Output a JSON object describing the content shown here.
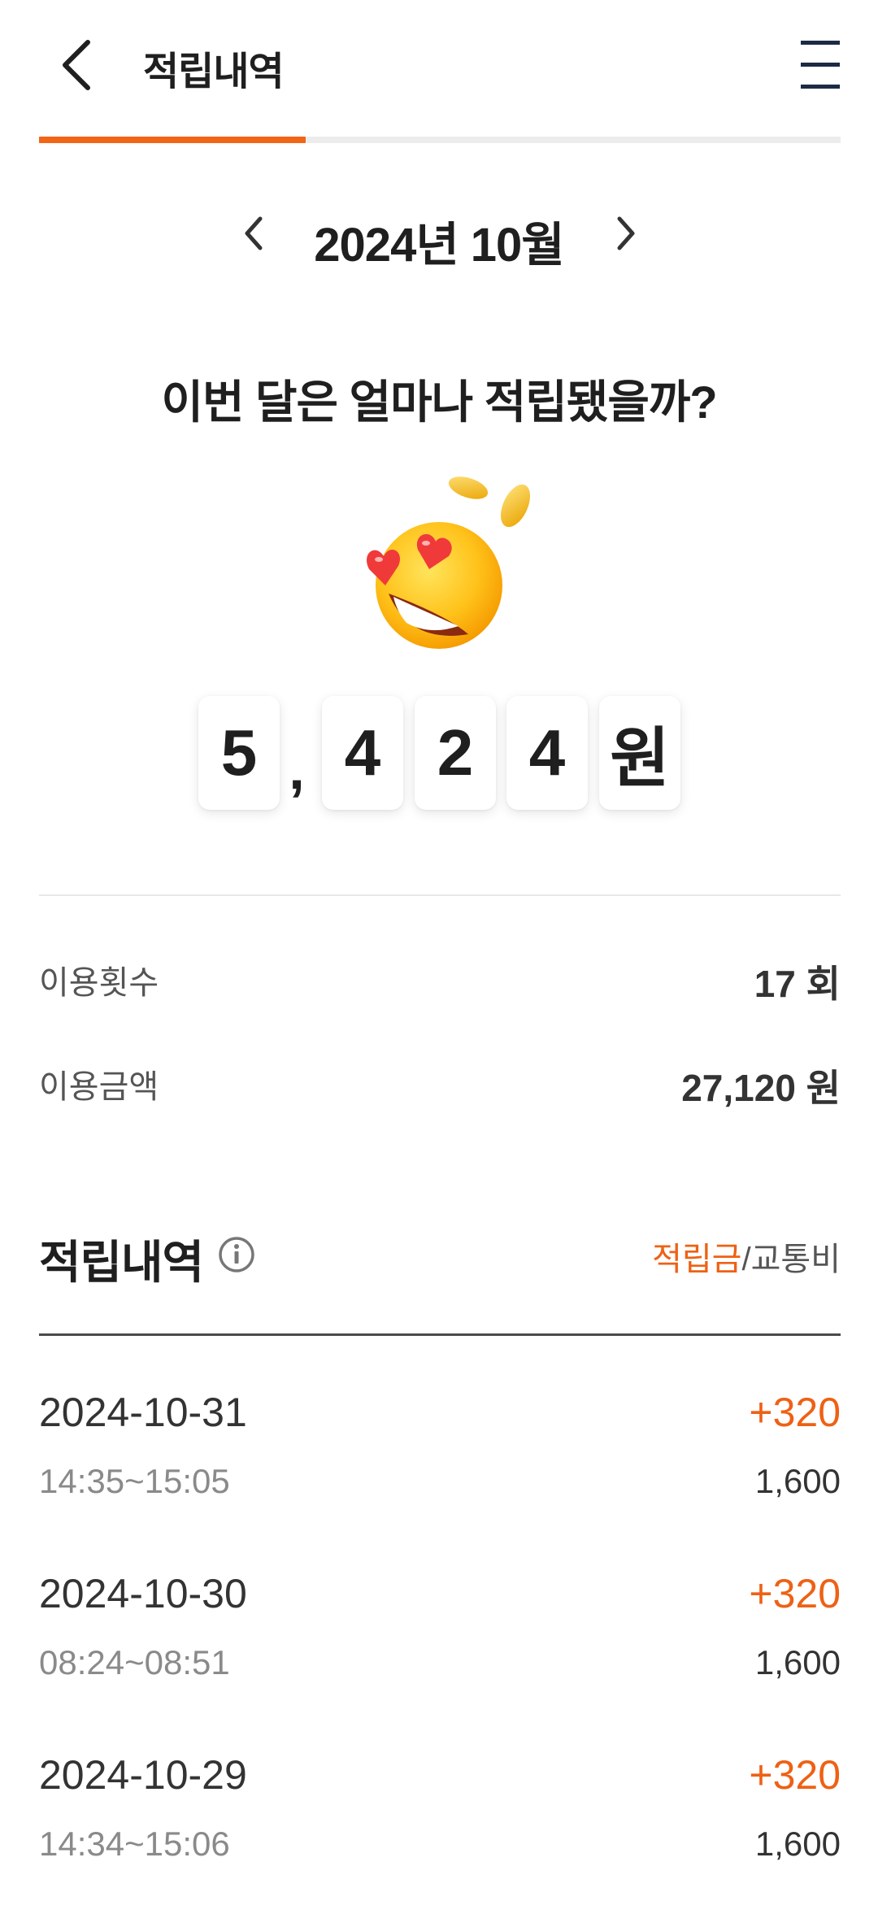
{
  "header": {
    "title": "적립내역",
    "back_icon": "chevron-left-icon",
    "menu_icon": "hamburger-menu-icon"
  },
  "progress": {
    "fraction": 0.333,
    "accent_color": "#f26516"
  },
  "month_nav": {
    "label": "2024년 10월",
    "prev_icon": "chevron-left-icon",
    "next_icon": "chevron-right-icon"
  },
  "question": "이번 달은 얼마나 적립됐을까?",
  "illustration": "heart-eyes-emoji-with-coins",
  "amount": {
    "digits": [
      "5",
      ",",
      "4",
      "2",
      "4",
      "원"
    ]
  },
  "stats": {
    "usage_count_label": "이용횟수",
    "usage_count_value": "17 회",
    "usage_amount_label": "이용금액",
    "usage_amount_value": "27,120 원"
  },
  "history": {
    "title": "적립내역",
    "info_icon": "info-circle-icon",
    "toggle_active": "적립금",
    "toggle_separator": "/",
    "toggle_inactive": "교통비",
    "entries": [
      {
        "date": "2024-10-31",
        "time": "14:35~15:05",
        "points": "+320",
        "fare": "1,600"
      },
      {
        "date": "2024-10-30",
        "time": "08:24~08:51",
        "points": "+320",
        "fare": "1,600"
      },
      {
        "date": "2024-10-29",
        "time": "14:34~15:06",
        "points": "+320",
        "fare": "1,600"
      }
    ]
  },
  "colors": {
    "accent": "#ee6115",
    "text_primary": "#1f1f1f",
    "text_secondary": "#8a8a8a"
  }
}
